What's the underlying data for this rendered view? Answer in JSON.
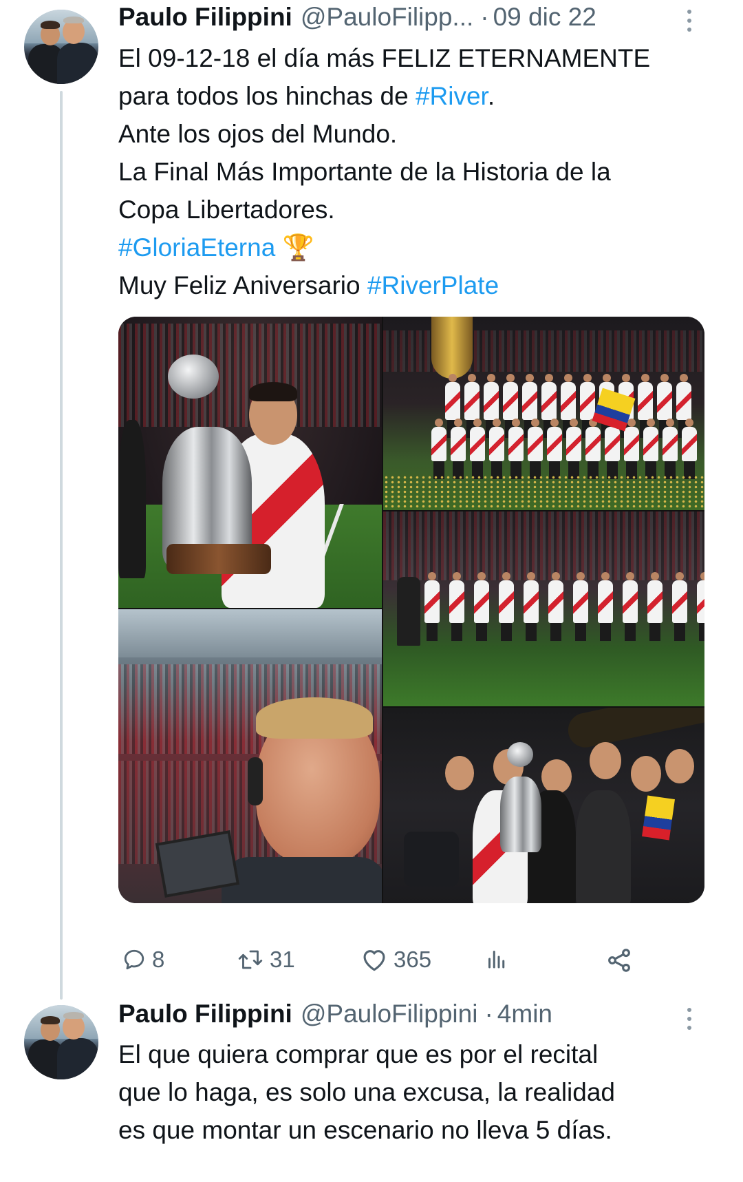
{
  "tweets": [
    {
      "author_name": "Paulo Filippini",
      "author_handle": "@PauloFilipp...",
      "separator": "·",
      "time": "09 dic 22",
      "lines": [
        [
          {
            "t": "El 09-12-18 el día más FELIZ ETERNAMENTE"
          }
        ],
        [
          {
            "t": "para todos los hinchas de "
          },
          {
            "t": "#River",
            "tag": true
          },
          {
            "t": "."
          }
        ],
        [
          {
            "t": "Ante los ojos del Mundo."
          }
        ],
        [
          {
            "t": "La Final Más Importante de la Historia de la"
          }
        ],
        [
          {
            "t": "Copa Libertadores."
          }
        ],
        [
          {
            "t": "#GloriaEterna",
            "tag": true
          },
          {
            "t": " 🏆"
          }
        ],
        [
          {
            "t": "Muy Feliz Aniversario "
          },
          {
            "t": "#RiverPlate",
            "tag": true
          }
        ]
      ],
      "media": {
        "photos": [
          {
            "name": "photo-coach-with-trophy"
          },
          {
            "name": "photo-team-celebration-pitch"
          },
          {
            "name": "photo-players-walking-pitch"
          },
          {
            "name": "photo-selfie-stadium"
          },
          {
            "name": "photo-players-with-trophy"
          }
        ]
      },
      "actions": {
        "replies": "8",
        "reposts": "31",
        "likes": "365",
        "views_icon": "views-icon",
        "share_icon": "share-icon"
      }
    },
    {
      "author_name": "Paulo Filippini",
      "author_handle": "@PauloFilippini",
      "separator": "·",
      "time": "4min",
      "lines": [
        [
          {
            "t": "El que quiera comprar que es por el recital"
          }
        ],
        [
          {
            "t": "que lo haga, es solo una excusa, la realidad"
          }
        ],
        [
          {
            "t": "es que montar un escenario no lleva 5 días."
          }
        ]
      ]
    }
  ],
  "colors": {
    "text": "#0f1419",
    "secondary": "#536471",
    "hashtag": "#1d9bf0",
    "thread_line": "#cfd9de"
  }
}
